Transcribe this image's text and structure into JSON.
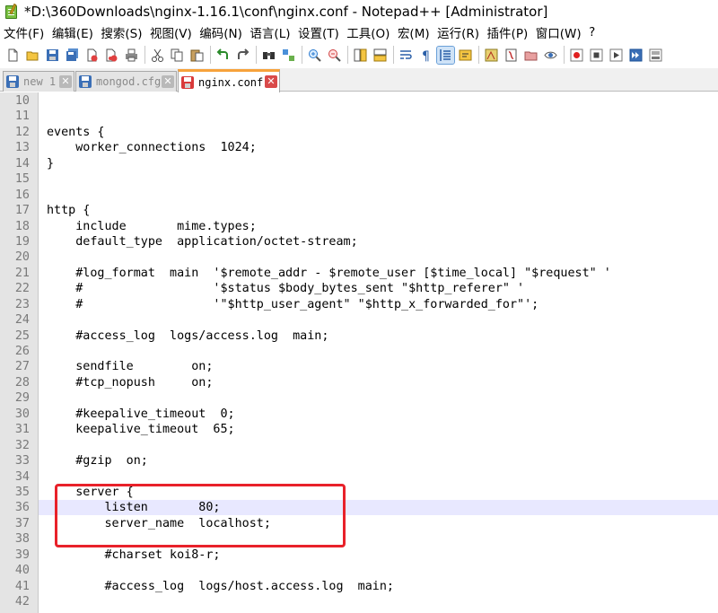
{
  "window": {
    "title": "*D:\\360Downloads\\nginx-1.16.1\\conf\\nginx.conf - Notepad++ [Administrator]"
  },
  "menu": {
    "items": [
      "文件(F)",
      "编辑(E)",
      "搜索(S)",
      "视图(V)",
      "编码(N)",
      "语言(L)",
      "设置(T)",
      "工具(O)",
      "宏(M)",
      "运行(R)",
      "插件(P)",
      "窗口(W)",
      "?"
    ]
  },
  "toolbar": {
    "buttons": [
      "new-file",
      "open-file",
      "save",
      "save-all",
      "close",
      "close-all",
      "print",
      "cut",
      "copy",
      "paste",
      "undo",
      "redo",
      "find",
      "replace",
      "zoom-in",
      "zoom-out",
      "sync-vertical",
      "sync-horizontal",
      "word-wrap",
      "show-all-chars",
      "indent-guide",
      "user-language",
      "doc-map",
      "function-list",
      "folder-workspace",
      "monitoring",
      "record-macro",
      "stop-record",
      "play-macro",
      "run-macro-multiple",
      "save-macro"
    ]
  },
  "tabs": [
    {
      "label": "new 1",
      "icon": "save-icon-blue",
      "active": false
    },
    {
      "label": "mongod.cfg",
      "icon": "save-icon-blue",
      "active": false
    },
    {
      "label": "nginx.conf",
      "icon": "save-icon-red",
      "active": true
    }
  ],
  "editor": {
    "current_line": 36,
    "line_numbers": [
      "10",
      "11",
      "12",
      "13",
      "14",
      "15",
      "16",
      "17",
      "18",
      "19",
      "20",
      "21",
      "22",
      "23",
      "24",
      "25",
      "26",
      "27",
      "28",
      "29",
      "30",
      "31",
      "32",
      "33",
      "34",
      "35",
      "36",
      "37",
      "38",
      "39",
      "40",
      "41",
      "42"
    ],
    "lines": [
      "",
      "",
      "events {",
      "    worker_connections  1024;",
      "}",
      "",
      "",
      "http {",
      "    include       mime.types;",
      "    default_type  application/octet-stream;",
      "",
      "    #log_format  main  '$remote_addr - $remote_user [$time_local] \"$request\" '",
      "    #                  '$status $body_bytes_sent \"$http_referer\" '",
      "    #                  '\"$http_user_agent\" \"$http_x_forwarded_for\"';",
      "",
      "    #access_log  logs/access.log  main;",
      "",
      "    sendfile        on;",
      "    #tcp_nopush     on;",
      "",
      "    #keepalive_timeout  0;",
      "    keepalive_timeout  65;",
      "",
      "    #gzip  on;",
      "",
      "    server {",
      "        listen       80;",
      "        server_name  localhost;",
      "",
      "        #charset koi8-r;",
      "",
      "        #access_log  logs/host.access.log  main;",
      ""
    ]
  },
  "annotation": {
    "color": "#e8212a"
  }
}
